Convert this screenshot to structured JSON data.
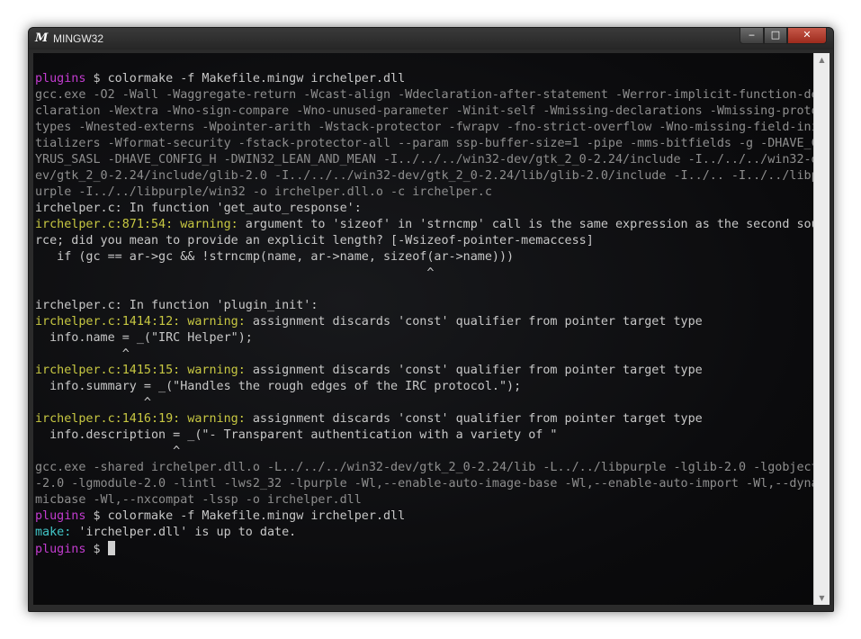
{
  "window": {
    "title": "MINGW32",
    "icon": "mingw-logo-icon",
    "controls": {
      "minimize": "‒",
      "maximize": "□",
      "close": "✕"
    }
  },
  "colors": {
    "prompt": "#c23ccf",
    "warning": "#c8c842",
    "gcc_output": "#8e8e8e",
    "text": "#c8c8c8",
    "make": "#42c6c8"
  },
  "terminal": {
    "prompt_dir": "plugins",
    "lines": [
      {
        "segments": [
          {
            "cls": "p",
            "text": "plugins"
          },
          {
            "cls": "t",
            "text": " $ colormake -f Makefile.mingw irchelper.dll"
          }
        ]
      },
      {
        "segments": [
          {
            "cls": "g",
            "text": "gcc.exe -O2 -Wall -Waggregate-return -Wcast-align -Wdeclaration-after-statement -Werror-implicit-function-de"
          }
        ]
      },
      {
        "segments": [
          {
            "cls": "g",
            "text": "claration -Wextra -Wno-sign-compare -Wno-unused-parameter -Winit-self -Wmissing-declarations -Wmissing-proto"
          }
        ]
      },
      {
        "segments": [
          {
            "cls": "g",
            "text": "types -Wnested-externs -Wpointer-arith -Wstack-protector -fwrapv -fno-strict-overflow -Wno-missing-field-ini"
          }
        ]
      },
      {
        "segments": [
          {
            "cls": "g",
            "text": "tializers -Wformat-security -fstack-protector-all --param ssp-buffer-size=1 -pipe -mms-bitfields -g -DHAVE_C"
          }
        ]
      },
      {
        "segments": [
          {
            "cls": "g",
            "text": "YRUS_SASL -DHAVE_CONFIG_H -DWIN32_LEAN_AND_MEAN -I../../../win32-dev/gtk_2_0-2.24/include -I../../../win32-d"
          }
        ]
      },
      {
        "segments": [
          {
            "cls": "g",
            "text": "ev/gtk_2_0-2.24/include/glib-2.0 -I../../../win32-dev/gtk_2_0-2.24/lib/glib-2.0/include -I../.. -I../../libp"
          }
        ]
      },
      {
        "segments": [
          {
            "cls": "g",
            "text": "urple -I../../libpurple/win32 -o irchelper.dll.o -c irchelper.c"
          }
        ]
      },
      {
        "segments": [
          {
            "cls": "t",
            "text": "irchelper.c: In function 'get_auto_response':"
          }
        ]
      },
      {
        "segments": [
          {
            "cls": "w",
            "text": "irchelper.c:871:54: warning:"
          },
          {
            "cls": "t",
            "text": " argument to 'sizeof' in 'strncmp' call is the same expression as the second sou"
          }
        ]
      },
      {
        "segments": [
          {
            "cls": "t",
            "text": "rce; did you mean to provide an explicit length? [-Wsizeof-pointer-memaccess]"
          }
        ]
      },
      {
        "segments": [
          {
            "cls": "t",
            "text": "   if (gc == ar->gc && !strncmp(name, ar->name, sizeof(ar->name)))"
          }
        ]
      },
      {
        "segments": [
          {
            "cls": "t",
            "text": "                                                      ^"
          }
        ]
      },
      {
        "segments": [
          {
            "cls": "t",
            "text": ""
          }
        ]
      },
      {
        "segments": [
          {
            "cls": "t",
            "text": "irchelper.c: In function 'plugin_init':"
          }
        ]
      },
      {
        "segments": [
          {
            "cls": "w",
            "text": "irchelper.c:1414:12: warning:"
          },
          {
            "cls": "t",
            "text": " assignment discards 'const' qualifier from pointer target type"
          }
        ]
      },
      {
        "segments": [
          {
            "cls": "t",
            "text": "  info.name = _(\"IRC Helper\");"
          }
        ]
      },
      {
        "segments": [
          {
            "cls": "t",
            "text": "            ^"
          }
        ]
      },
      {
        "segments": [
          {
            "cls": "w",
            "text": "irchelper.c:1415:15: warning:"
          },
          {
            "cls": "t",
            "text": " assignment discards 'const' qualifier from pointer target type"
          }
        ]
      },
      {
        "segments": [
          {
            "cls": "t",
            "text": "  info.summary = _(\"Handles the rough edges of the IRC protocol.\");"
          }
        ]
      },
      {
        "segments": [
          {
            "cls": "t",
            "text": "               ^"
          }
        ]
      },
      {
        "segments": [
          {
            "cls": "w",
            "text": "irchelper.c:1416:19: warning:"
          },
          {
            "cls": "t",
            "text": " assignment discards 'const' qualifier from pointer target type"
          }
        ]
      },
      {
        "segments": [
          {
            "cls": "t",
            "text": "  info.description = _(\"- Transparent authentication with a variety of \""
          }
        ]
      },
      {
        "segments": [
          {
            "cls": "t",
            "text": "                   ^"
          }
        ]
      },
      {
        "segments": [
          {
            "cls": "g",
            "text": "gcc.exe -shared irchelper.dll.o -L../../../win32-dev/gtk_2_0-2.24/lib -L../../libpurple -lglib-2.0 -lgobject"
          }
        ]
      },
      {
        "segments": [
          {
            "cls": "g",
            "text": "-2.0 -lgmodule-2.0 -lintl -lws2_32 -lpurple -Wl,--enable-auto-image-base -Wl,--enable-auto-import -Wl,--dyna"
          }
        ]
      },
      {
        "segments": [
          {
            "cls": "g",
            "text": "micbase -Wl,--nxcompat -lssp -o irchelper.dll"
          }
        ]
      },
      {
        "segments": [
          {
            "cls": "p",
            "text": "plugins"
          },
          {
            "cls": "t",
            "text": " $ colormake -f Makefile.mingw irchelper.dll"
          }
        ]
      },
      {
        "segments": [
          {
            "cls": "m",
            "text": "make:"
          },
          {
            "cls": "t",
            "text": " 'irchelper.dll' is up to date."
          }
        ]
      }
    ],
    "current_prompt": {
      "dir": "plugins",
      "symbol": " $ "
    }
  }
}
